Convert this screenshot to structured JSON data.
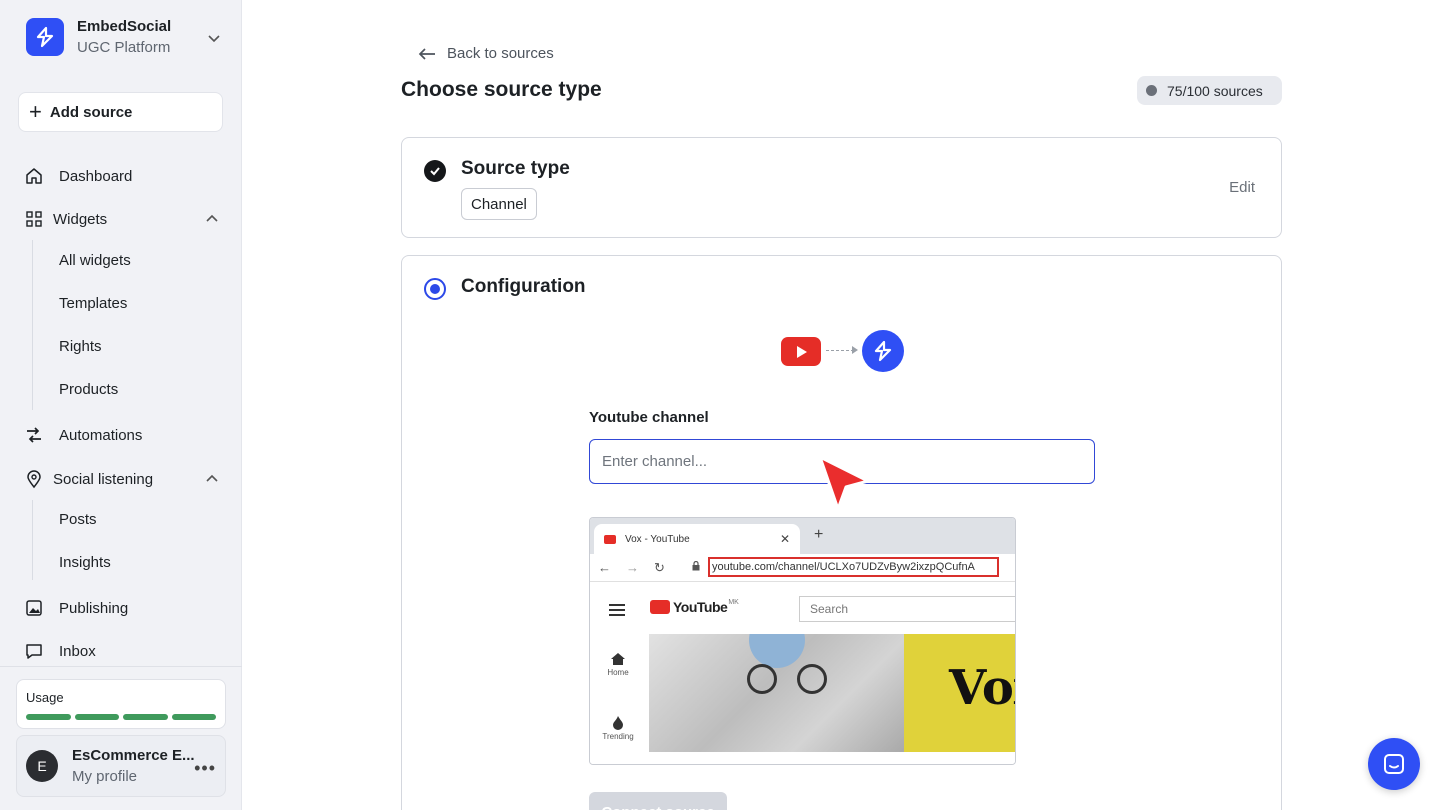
{
  "brand": {
    "name": "EmbedSocial",
    "subtitle": "UGC Platform"
  },
  "sidebar": {
    "add_source": "Add source",
    "items": {
      "dashboard": "Dashboard",
      "widgets": "Widgets",
      "all_widgets": "All widgets",
      "templates": "Templates",
      "rights": "Rights",
      "products": "Products",
      "automations": "Automations",
      "social_listening": "Social listening",
      "posts": "Posts",
      "insights": "Insights",
      "publishing": "Publishing",
      "inbox": "Inbox"
    },
    "usage": {
      "label": "Usage",
      "segments_filled": 4,
      "segments_total": 4
    },
    "profile": {
      "initial": "E",
      "name": "EsCommerce E...",
      "subtitle": "My profile"
    }
  },
  "main": {
    "back_link": "Back to sources",
    "title": "Choose source type",
    "sources_badge": "75/100 sources",
    "source_type_card": {
      "title": "Source type",
      "chip": "Channel",
      "edit": "Edit"
    },
    "configuration_card": {
      "title": "Configuration",
      "field_label": "Youtube channel",
      "field_placeholder": "Enter channel...",
      "field_value": "",
      "connect_button": "Connect source"
    },
    "example_screenshot": {
      "tab_title": "Vox - YouTube",
      "url": "youtube.com/channel/UCLXo7UDZvByw2ixzpQCufnA",
      "youtube_word": "YouTube",
      "region": "MK",
      "search": "Search",
      "side_home": "Home",
      "side_trending": "Trending",
      "banner_text": "Vox"
    }
  },
  "colors": {
    "brand_blue": "#2f4ff5",
    "youtube_red": "#e52d27",
    "usage_green": "#3f9a5c",
    "focus_border": "#3148d6"
  },
  "icons": [
    "embedsocial-logo-icon",
    "chevron-down-icon",
    "plus-icon",
    "home-icon",
    "grid-icon",
    "chevron-up-icon",
    "automations-icon",
    "location-pin-icon",
    "image-icon",
    "chat-bubble-icon",
    "more-icon",
    "arrow-left-icon",
    "check-icon",
    "youtube-icon",
    "arrow-right-icon",
    "pointer-cursor-icon",
    "lock-icon",
    "messenger-icon"
  ]
}
